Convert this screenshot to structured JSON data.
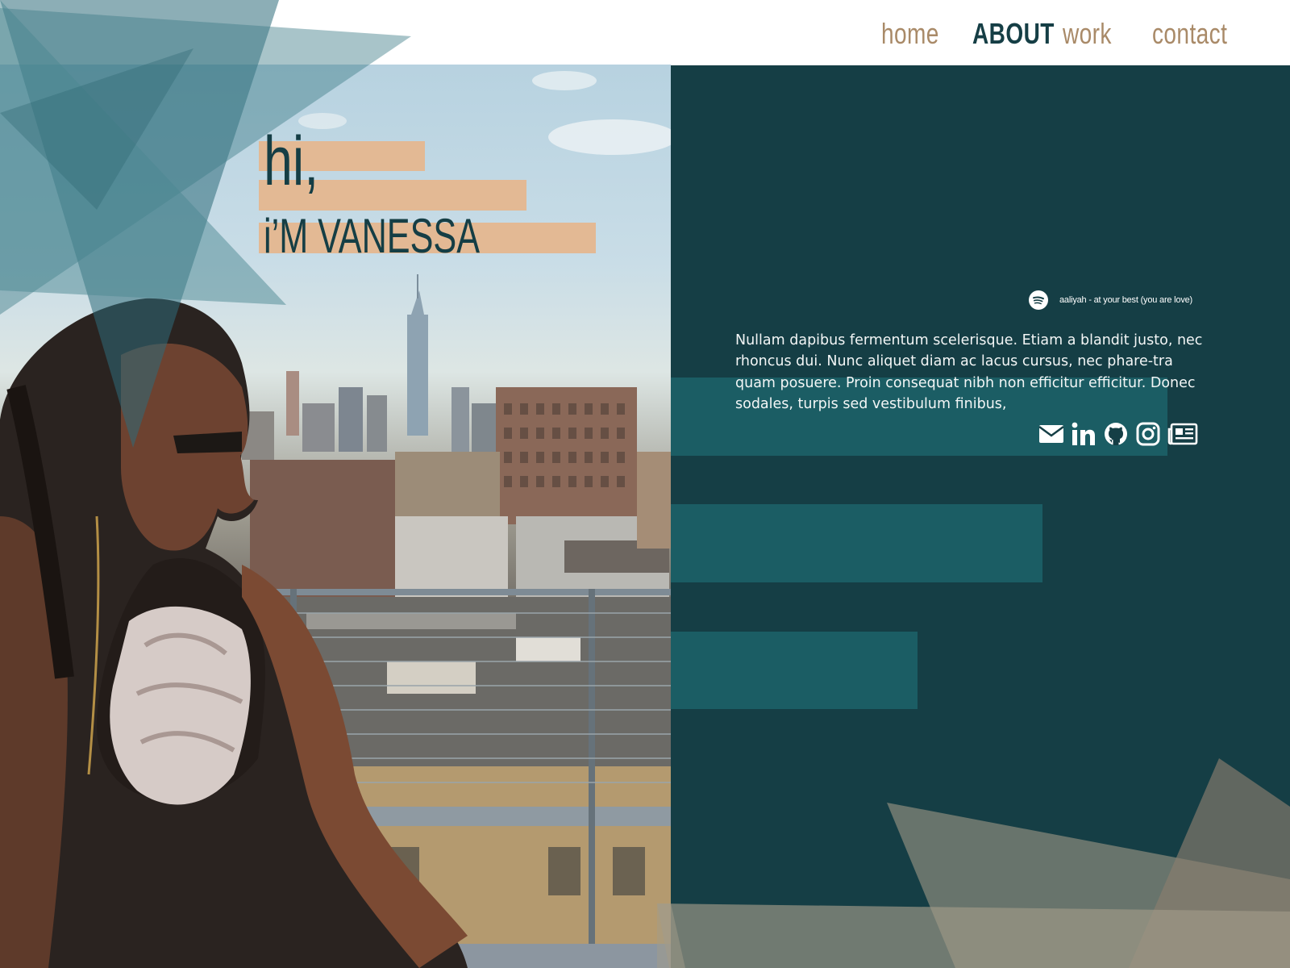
{
  "nav": {
    "items": [
      {
        "label": "home"
      },
      {
        "label": "ABOUT"
      },
      {
        "label": "work"
      },
      {
        "label": "contact"
      }
    ],
    "active": "ABOUT"
  },
  "hero": {
    "greeting": "hi,",
    "name": "i’M VANESSA"
  },
  "player": {
    "icon": "spotify-icon",
    "track": "aaliyah - at your best (you are love)"
  },
  "bio": {
    "text": "Nullam dapibus fermentum scelerisque. Etiam a blandit justo, nec rhoncus dui. Nunc aliquet diam ac lacus cursus, nec phare-tra quam posuere. Proin consequat nibh non efficitur efficitur. Donec sodales, turpis sed vestibulum finibus,"
  },
  "social": {
    "icons": [
      "envelope-icon",
      "linkedin-icon",
      "github-icon",
      "instagram-icon",
      "newspaper-icon"
    ]
  },
  "colors": {
    "nav_link": "#a98a68",
    "nav_active": "#153e45",
    "panel": "#153e45",
    "panel_bar": "#1b5d64",
    "highlight": "#e3b994",
    "text_light": "#f3f6f6"
  }
}
